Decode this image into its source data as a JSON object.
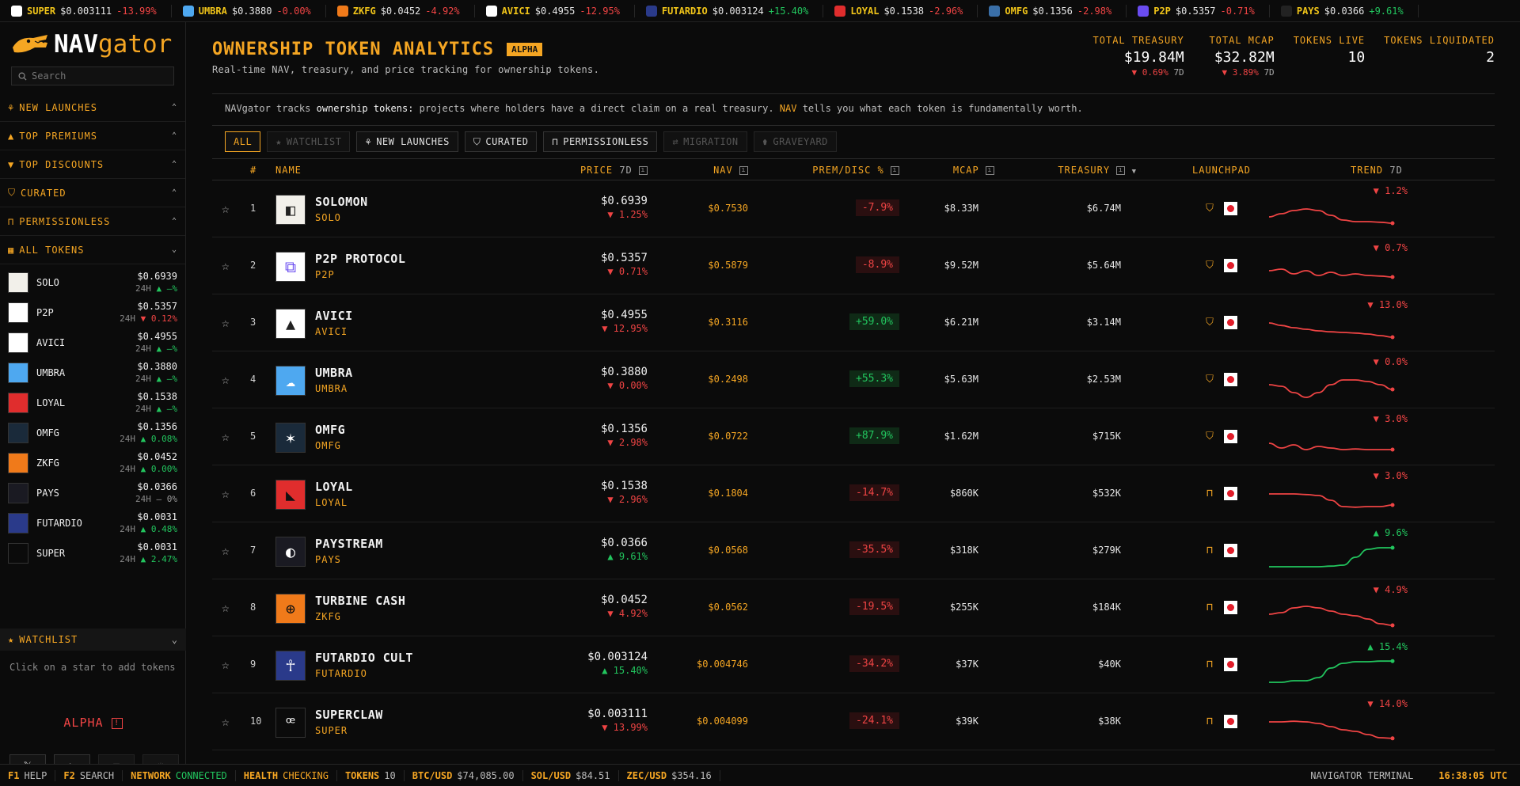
{
  "ticker": [
    {
      "sym": "SUPER",
      "price": "$0.003111",
      "change": "-13.99%",
      "dir": "down",
      "color": "#ffffff",
      "icon": "super-icon"
    },
    {
      "sym": "UMBRA",
      "price": "$0.3880",
      "change": "-0.00%",
      "dir": "down",
      "color": "#4ea8f0",
      "icon": "umbra-icon"
    },
    {
      "sym": "ZKFG",
      "price": "$0.0452",
      "change": "-4.92%",
      "dir": "down",
      "color": "#f07a1a",
      "icon": "zkfg-icon"
    },
    {
      "sym": "AVICI",
      "price": "$0.4955",
      "change": "-12.95%",
      "dir": "down",
      "color": "#ffffff",
      "icon": "avici-icon"
    },
    {
      "sym": "FUTARDIO",
      "price": "$0.003124",
      "change": "+15.40%",
      "dir": "up",
      "color": "#2a3a8a",
      "icon": "futardio-icon"
    },
    {
      "sym": "LOYAL",
      "price": "$0.1538",
      "change": "-2.96%",
      "dir": "down",
      "color": "#e02d2d",
      "icon": "loyal-icon"
    },
    {
      "sym": "OMFG",
      "price": "$0.1356",
      "change": "-2.98%",
      "dir": "down",
      "color": "#3a6fa8",
      "icon": "omfg-icon"
    },
    {
      "sym": "P2P",
      "price": "$0.5357",
      "change": "-0.71%",
      "dir": "down",
      "color": "#6a4cf0",
      "icon": "p2p-icon"
    },
    {
      "sym": "PAYS",
      "price": "$0.0366",
      "change": "+9.61%",
      "dir": "up",
      "color": "#222",
      "icon": "pays-icon"
    }
  ],
  "logo": {
    "nav": "NAV",
    "gator": "gator"
  },
  "search": {
    "placeholder": "Search"
  },
  "sections": [
    {
      "label": "NEW LAUNCHES",
      "icon": "sprout-icon",
      "glyph": "⚘",
      "chev": "⌃"
    },
    {
      "label": "TOP PREMIUMS",
      "icon": "triangle-up-icon",
      "glyph": "▲",
      "chev": "⌃"
    },
    {
      "label": "TOP DISCOUNTS",
      "icon": "triangle-down-icon",
      "glyph": "▼",
      "chev": "⌃"
    },
    {
      "label": "CURATED",
      "icon": "shield-check-icon",
      "glyph": "⛉",
      "chev": "⌃"
    },
    {
      "label": "PERMISSIONLESS",
      "icon": "lock-open-icon",
      "glyph": "⊓",
      "chev": "⌃"
    },
    {
      "label": "ALL TOKENS",
      "icon": "grid-icon",
      "glyph": "▦",
      "chev": "⌄"
    }
  ],
  "side_tokens": [
    {
      "sym": "SOLO",
      "price": "$0.6939",
      "change": "▲ —%",
      "dir": "up",
      "bg": "#f2f0ea",
      "fg": "#222"
    },
    {
      "sym": "P2P",
      "price": "$0.5357",
      "change": "▼ 0.12%",
      "dir": "down",
      "bg": "#ffffff",
      "fg": "#6a4cf0"
    },
    {
      "sym": "AVICI",
      "price": "$0.4955",
      "change": "▲ —%",
      "dir": "up",
      "bg": "#ffffff",
      "fg": "#222"
    },
    {
      "sym": "UMBRA",
      "price": "$0.3880",
      "change": "▲ —%",
      "dir": "up",
      "bg": "#4ea8f0",
      "fg": "#ffffff"
    },
    {
      "sym": "LOYAL",
      "price": "$0.1538",
      "change": "▲ —%",
      "dir": "up",
      "bg": "#e02d2d",
      "fg": "#111"
    },
    {
      "sym": "OMFG",
      "price": "$0.1356",
      "change": "▲ 0.08%",
      "dir": "up",
      "bg": "#1a2a3a",
      "fg": "#ffffff"
    },
    {
      "sym": "ZKFG",
      "price": "$0.0452",
      "change": "▲ 0.00%",
      "dir": "up",
      "bg": "#f07a1a",
      "fg": "#111"
    },
    {
      "sym": "PAYS",
      "price": "$0.0366",
      "change": "— 0%",
      "dir": "flat",
      "bg": "#1a1a22",
      "fg": "#ffffff"
    },
    {
      "sym": "FUTARDIO",
      "price": "$0.0031",
      "change": "▲ 0.48%",
      "dir": "up",
      "bg": "#2a3a8a",
      "fg": "#ffffff"
    },
    {
      "sym": "SUPER",
      "price": "$0.0031",
      "change": "▲ 2.47%",
      "dir": "up",
      "bg": "#0b0b0b",
      "fg": "#ffffff"
    }
  ],
  "side_change_prefix": "24H",
  "watchlist": {
    "title": "WATCHLIST",
    "hint": "Click on a star to add tokens",
    "glyph": "★",
    "chev": "⌄"
  },
  "alpha_label": "ALPHA",
  "alpha_glyph": "!",
  "footer_buttons": [
    {
      "name": "x-social-button",
      "glyph": "𝕏",
      "dim": false
    },
    {
      "name": "telegram-button",
      "glyph": "➤",
      "dim": false
    },
    {
      "name": "docs-button",
      "glyph": "▤",
      "dim": true
    },
    {
      "name": "theme-toggle-button",
      "glyph": "☼",
      "dim": true
    }
  ],
  "header": {
    "title": "OWNERSHIP TOKEN ANALYTICS",
    "badge": "ALPHA",
    "subtitle": "Real-time NAV, treasury, and price tracking for ownership tokens."
  },
  "stats": [
    {
      "label": "TOTAL TREASURY",
      "value": "$19.84M",
      "delta": "▼ 0.69%",
      "period": "7D"
    },
    {
      "label": "TOTAL MCAP",
      "value": "$32.82M",
      "delta": "▼ 3.89%",
      "period": "7D"
    },
    {
      "label": "TOKENS LIVE",
      "value": "10",
      "delta": "",
      "period": ""
    },
    {
      "label": "TOKENS LIQUIDATED",
      "value": "2",
      "delta": "",
      "period": ""
    }
  ],
  "intro": {
    "p1": "NAVgator tracks ",
    "b1": "ownership tokens:",
    "p2": " projects where holders have a direct claim on a real treasury. ",
    "nav": "NAV",
    "p3": " tells you what each token is fundamentally worth."
  },
  "filters": [
    {
      "label": "ALL",
      "glyph": "",
      "state": "active"
    },
    {
      "label": "WATCHLIST",
      "glyph": "★",
      "state": "dim"
    },
    {
      "label": "NEW LAUNCHES",
      "glyph": "⚘",
      "state": ""
    },
    {
      "label": "CURATED",
      "glyph": "⛉",
      "state": ""
    },
    {
      "label": "PERMISSIONLESS",
      "glyph": "⊓",
      "state": ""
    },
    {
      "label": "MIGRATION",
      "glyph": "⇄",
      "state": "dim"
    },
    {
      "label": "GRAVEYARD",
      "glyph": "⚱",
      "state": "dim"
    }
  ],
  "columns": {
    "rank": "#",
    "name": "NAME",
    "price": "PRICE",
    "price_period": "7D",
    "info": "i",
    "nav": "NAV",
    "prem": "PREM/DISC %",
    "mcap": "MCAP",
    "treasury": "TREASURY",
    "sort": "▼",
    "launchpad": "LAUNCHPAD",
    "trend": "TREND",
    "trend_period": "7D"
  },
  "rows": [
    {
      "rank": "1",
      "name": "SOLOMON",
      "sym": "SOLO",
      "price": "$0.6939",
      "pchange": "▼ 1.25%",
      "pdir": "down",
      "nav": "$0.7530",
      "prem": "-7.9%",
      "pdir2": "neg",
      "mcap": "$8.33M",
      "treasury": "$6.74M",
      "lp": "curated",
      "trend": "▼ 1.2%",
      "tdir": "down",
      "spark": [
        0.55,
        0.45,
        0.35,
        0.3,
        0.35,
        0.5,
        0.65,
        0.7,
        0.7,
        0.72,
        0.75
      ],
      "bg": "#f2f0ea",
      "fg": "#222",
      "glyph": "◧"
    },
    {
      "rank": "2",
      "name": "P2P PROTOCOL",
      "sym": "P2P",
      "price": "$0.5357",
      "pchange": "▼ 0.71%",
      "pdir": "down",
      "nav": "$0.5879",
      "prem": "-8.9%",
      "pdir2": "neg",
      "mcap": "$9.52M",
      "treasury": "$5.64M",
      "lp": "curated",
      "trend": "▼ 0.7%",
      "tdir": "down",
      "spark": [
        0.45,
        0.4,
        0.55,
        0.45,
        0.6,
        0.5,
        0.6,
        0.55,
        0.6,
        0.62,
        0.65
      ],
      "bg": "#ffffff",
      "fg": "#6a4cf0",
      "glyph": "⧉"
    },
    {
      "rank": "3",
      "name": "AVICI",
      "sym": "AVICI",
      "price": "$0.4955",
      "pchange": "▼ 12.95%",
      "pdir": "down",
      "nav": "$0.3116",
      "prem": "+59.0%",
      "pdir2": "pos",
      "mcap": "$6.21M",
      "treasury": "$3.14M",
      "lp": "curated",
      "trend": "▼ 13.0%",
      "tdir": "down",
      "spark": [
        0.3,
        0.38,
        0.45,
        0.5,
        0.55,
        0.58,
        0.6,
        0.62,
        0.65,
        0.7,
        0.75
      ],
      "bg": "#ffffff",
      "fg": "#222",
      "glyph": "▲"
    },
    {
      "rank": "4",
      "name": "UMBRA",
      "sym": "UMBRA",
      "price": "$0.3880",
      "pchange": "▼ 0.00%",
      "pdir": "down",
      "nav": "$0.2498",
      "prem": "+55.3%",
      "pdir2": "pos",
      "mcap": "$5.63M",
      "treasury": "$2.53M",
      "lp": "curated",
      "trend": "▼ 0.0%",
      "tdir": "down",
      "spark": [
        0.45,
        0.5,
        0.7,
        0.85,
        0.7,
        0.45,
        0.3,
        0.3,
        0.35,
        0.45,
        0.6
      ],
      "bg": "#4ea8f0",
      "fg": "#ffffff",
      "glyph": "☁"
    },
    {
      "rank": "5",
      "name": "OMFG",
      "sym": "OMFG",
      "price": "$0.1356",
      "pchange": "▼ 2.98%",
      "pdir": "down",
      "nav": "$0.0722",
      "prem": "+87.9%",
      "pdir2": "pos",
      "mcap": "$1.62M",
      "treasury": "$715K",
      "lp": "curated",
      "trend": "▼ 3.0%",
      "tdir": "down",
      "spark": [
        0.5,
        0.65,
        0.55,
        0.7,
        0.6,
        0.65,
        0.7,
        0.68,
        0.7,
        0.7,
        0.7
      ],
      "bg": "#1a2a3a",
      "fg": "#ffffff",
      "glyph": "✶"
    },
    {
      "rank": "6",
      "name": "LOYAL",
      "sym": "LOYAL",
      "price": "$0.1538",
      "pchange": "▼ 2.96%",
      "pdir": "down",
      "nav": "$0.1804",
      "prem": "-14.7%",
      "pdir2": "neg",
      "mcap": "$860K",
      "treasury": "$532K",
      "lp": "permissionless",
      "trend": "▼ 3.0%",
      "tdir": "down",
      "spark": [
        0.3,
        0.3,
        0.3,
        0.32,
        0.35,
        0.5,
        0.7,
        0.72,
        0.7,
        0.7,
        0.65
      ],
      "bg": "#e02d2d",
      "fg": "#111",
      "glyph": "◣"
    },
    {
      "rank": "7",
      "name": "PAYSTREAM",
      "sym": "PAYS",
      "price": "$0.0366",
      "pchange": "▲ 9.61%",
      "pdir": "up",
      "nav": "$0.0568",
      "prem": "-35.5%",
      "pdir2": "neg",
      "mcap": "$318K",
      "treasury": "$279K",
      "lp": "permissionless",
      "trend": "▲ 9.6%",
      "tdir": "up",
      "spark": [
        0.8,
        0.8,
        0.8,
        0.8,
        0.8,
        0.78,
        0.75,
        0.5,
        0.25,
        0.2,
        0.2
      ],
      "bg": "#1a1a22",
      "fg": "#ffffff",
      "glyph": "◐"
    },
    {
      "rank": "8",
      "name": "TURBINE CASH",
      "sym": "ZKFG",
      "price": "$0.0452",
      "pchange": "▼ 4.92%",
      "pdir": "down",
      "nav": "$0.0562",
      "prem": "-19.5%",
      "pdir2": "neg",
      "mcap": "$255K",
      "treasury": "$184K",
      "lp": "permissionless",
      "trend": "▼ 4.9%",
      "tdir": "down",
      "spark": [
        0.5,
        0.45,
        0.3,
        0.25,
        0.3,
        0.4,
        0.5,
        0.55,
        0.65,
        0.8,
        0.85
      ],
      "bg": "#f07a1a",
      "fg": "#111",
      "glyph": "⊕"
    },
    {
      "rank": "9",
      "name": "FUTARDIO CULT",
      "sym": "FUTARDIO",
      "price": "$0.003124",
      "pchange": "▲ 15.40%",
      "pdir": "up",
      "nav": "$0.004746",
      "prem": "-34.2%",
      "pdir2": "neg",
      "mcap": "$37K",
      "treasury": "$40K",
      "lp": "permissionless",
      "trend": "▲ 15.4%",
      "tdir": "up",
      "spark": [
        0.85,
        0.85,
        0.8,
        0.8,
        0.7,
        0.4,
        0.25,
        0.2,
        0.2,
        0.18,
        0.18
      ],
      "bg": "#2a3a8a",
      "fg": "#ffffff",
      "glyph": "☥"
    },
    {
      "rank": "10",
      "name": "SUPERCLAW",
      "sym": "SUPER",
      "price": "$0.003111",
      "pchange": "▼ 13.99%",
      "pdir": "down",
      "nav": "$0.004099",
      "prem": "-24.1%",
      "pdir2": "neg",
      "mcap": "$39K",
      "treasury": "$38K",
      "lp": "permissionless",
      "trend": "▼ 14.0%",
      "tdir": "down",
      "spark": [
        0.3,
        0.3,
        0.28,
        0.3,
        0.35,
        0.45,
        0.55,
        0.6,
        0.7,
        0.8,
        0.82
      ],
      "bg": "#0b0b0b",
      "fg": "#ffffff",
      "glyph": "ꟹ"
    }
  ],
  "lp_glyphs": {
    "curated": "⛉",
    "permissionless": "⊓"
  },
  "status": [
    {
      "k": "F1",
      "v": "HELP",
      "cls": ""
    },
    {
      "k": "F2",
      "v": "SEARCH",
      "cls": ""
    },
    {
      "k": "NETWORK",
      "v": "CONNECTED",
      "cls": "g"
    },
    {
      "k": "HEALTH",
      "v": "CHECKING",
      "cls": "y"
    },
    {
      "k": "TOKENS",
      "v": "10",
      "cls": ""
    },
    {
      "k": "BTC/USD",
      "v": "$74,085.00",
      "cls": ""
    },
    {
      "k": "SOL/USD",
      "v": "$84.51",
      "cls": ""
    },
    {
      "k": "ZEC/USD",
      "v": "$354.16",
      "cls": ""
    }
  ],
  "status_right": {
    "label": "NAVIGATOR TERMINAL",
    "time": "16:38:05 UTC"
  },
  "colors": {
    "accent": "#f5a623",
    "up": "#22c55e",
    "down": "#ef4444"
  }
}
